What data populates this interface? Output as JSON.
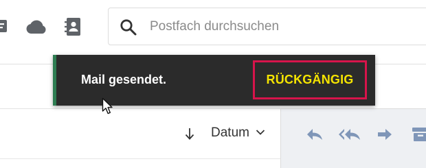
{
  "search": {
    "placeholder": "Postfach durchsuchen"
  },
  "toolbar_icons": [
    "notes-icon",
    "cloud-icon",
    "contacts-icon"
  ],
  "snackbar": {
    "message": "Mail gesendet.",
    "undo_label": "RÜCKGÄNGIG",
    "accent_color": "#2e7d52",
    "undo_color": "#f5e400",
    "highlight_color": "#d7144b"
  },
  "list": {
    "sort_label": "Datum"
  },
  "reading_pane_icons": [
    "reply-icon",
    "reply-all-icon",
    "forward-icon",
    "archive-icon"
  ],
  "colors": {
    "icon_gray": "#5f6368",
    "reading_icon": "#7f96b8"
  }
}
